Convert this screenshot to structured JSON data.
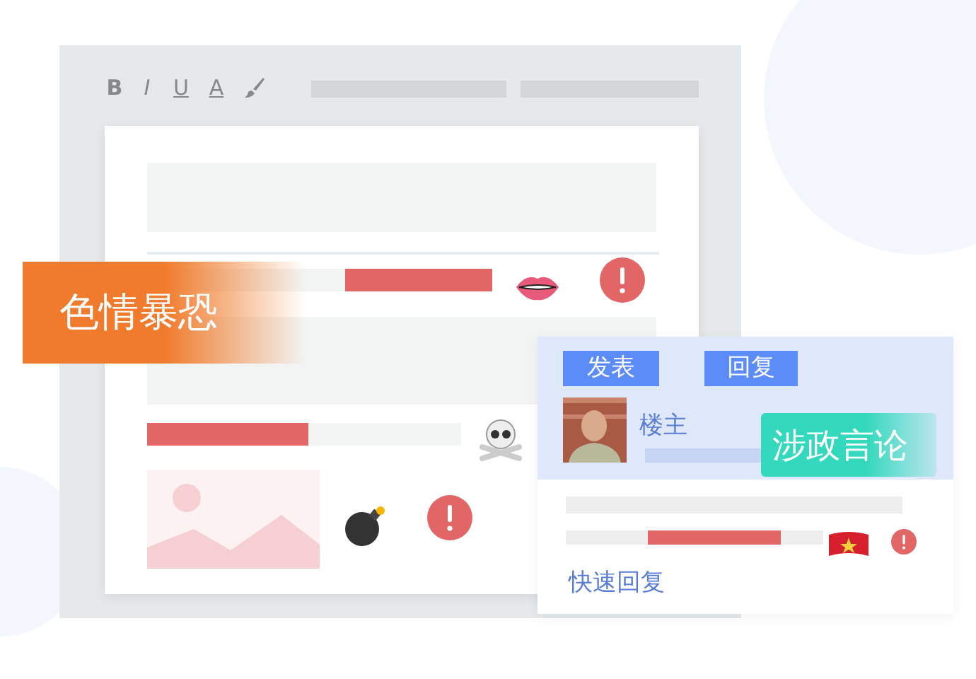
{
  "toolbar": {
    "buttons": [
      "B",
      "I",
      "U",
      "A"
    ]
  },
  "labels": [
    "色情暴恐",
    "涉政言论"
  ],
  "post": {
    "tabs": [
      "发表",
      "回复"
    ],
    "author": "楼主",
    "quick_reply": "快速回复"
  }
}
